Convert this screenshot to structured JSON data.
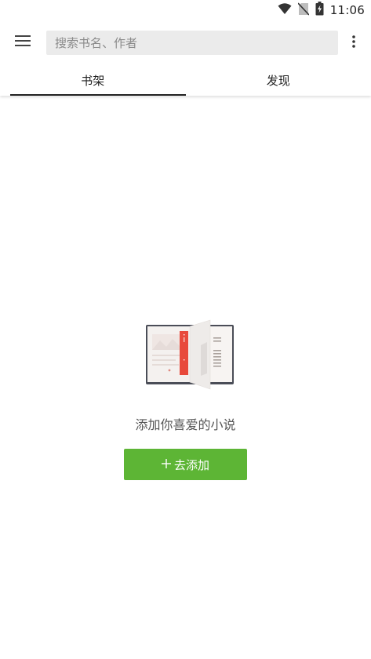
{
  "status_bar": {
    "time": "11:06",
    "icons": [
      "wifi-icon",
      "no-sim-icon",
      "battery-charging-icon"
    ]
  },
  "toolbar": {
    "search_placeholder": "搜索书名、作者",
    "menu_icon": "hamburger-menu-icon",
    "more_icon": "more-vert-icon"
  },
  "tabs": [
    {
      "label": "书架",
      "active": true
    },
    {
      "label": "发现",
      "active": false
    }
  ],
  "empty_state": {
    "message": "添加你喜爱的小说",
    "button_label": "去添加",
    "button_icon": "plus-icon",
    "illustration": "open-book-bookmark-icon"
  },
  "colors": {
    "accent_green": "#5db535",
    "search_bg": "#ebebeb",
    "bookmark_red": "#e84a3c"
  }
}
